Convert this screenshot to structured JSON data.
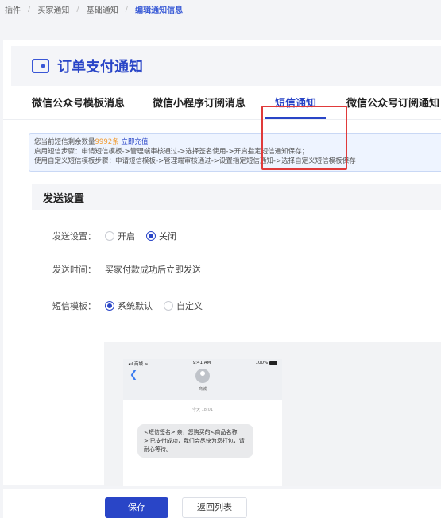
{
  "breadcrumb": {
    "items": [
      "插件",
      "买家通知",
      "基础通知"
    ],
    "current": "编辑通知信息"
  },
  "title": "订单支付通知",
  "tabs": [
    {
      "label": "微信公众号模板消息",
      "active": false
    },
    {
      "label": "微信小程序订阅消息",
      "active": false
    },
    {
      "label": "短信通知",
      "active": true
    },
    {
      "label": "微信公众号订阅通知",
      "active": false
    }
  ],
  "notice": {
    "line1_prefix": "您当前短信剩余数量",
    "count": "9992条",
    "link": "立即充值",
    "line2": "启用短信步骤：申请短信模板->管理端审核通过->选择签名使用->开启指定短信通知保存；",
    "line3": "使用自定义短信模板步骤：申请短信模板->管理端审核通过->设置指定短信通知->选择自定义短信模板保存"
  },
  "section_title": "发送设置",
  "form": {
    "send_setting": {
      "label": "发送设置：",
      "options": [
        "开启",
        "关闭"
      ],
      "selected": "关闭"
    },
    "send_time": {
      "label": "发送时间：",
      "value": "买家付款成功后立即发送"
    },
    "template": {
      "label": "短信模板：",
      "options": [
        "系统默认",
        "自定义"
      ],
      "selected": "系统默认"
    }
  },
  "preview": {
    "carrier": "•ıl 商城 ≈",
    "time": "9:41 AM",
    "battery": "100%",
    "contact": "商城",
    "msg_time": "今天 18:01",
    "message": "<短信签名>'亲，您购买的<商品名称>'已支付成功，我们会尽快为您打包，请耐心等待。"
  },
  "buttons": {
    "save": "保存",
    "back": "返回列表"
  },
  "colors": {
    "accent": "#2945c7",
    "highlight": "#e03a3a",
    "count": "#f29a2e"
  }
}
